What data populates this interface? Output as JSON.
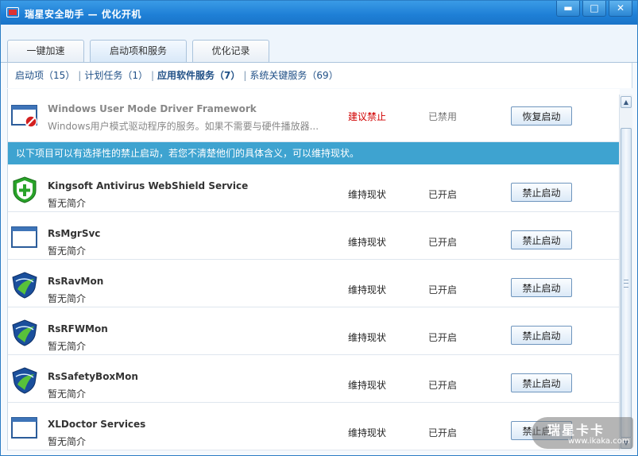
{
  "window": {
    "title": "瑞星安全助手 — 优化开机",
    "minimize_glyph": "▬",
    "maximize_glyph": "□",
    "close_glyph": "✕"
  },
  "tabs": [
    {
      "label": "一键加速",
      "active": false
    },
    {
      "label": "启动项和服务",
      "active": true
    },
    {
      "label": "优化记录",
      "active": false
    }
  ],
  "filters": [
    {
      "label": "启动项（15）",
      "active": false
    },
    {
      "label": "计划任务（1）",
      "active": false
    },
    {
      "label": "应用软件服务（7）",
      "active": true
    },
    {
      "label": "系统关键服务（69）",
      "active": false
    }
  ],
  "filter_separator": "|",
  "disabled_item": {
    "name": "Windows User Mode Driver Framework",
    "description": "Windows用户模式驱动程序的服务。如果不需要与硬件播放器...",
    "advice": "建议禁止",
    "status": "已禁用",
    "action": "恢复启动",
    "icon": "window-disabled-icon"
  },
  "notice": "以下项目可以有选择性的禁止启动，若您不清楚他们的具体含义，可以维持现状。",
  "items": [
    {
      "name": "Kingsoft Antivirus WebShield Service",
      "description": "暂无简介",
      "advice": "维持现状",
      "status": "已开启",
      "action": "禁止启动",
      "icon": "green-shield-icon"
    },
    {
      "name": "RsMgrSvc",
      "description": "暂无简介",
      "advice": "维持现状",
      "status": "已开启",
      "action": "禁止启动",
      "icon": "window-icon"
    },
    {
      "name": "RsRavMon",
      "description": "暂无简介",
      "advice": "维持现状",
      "status": "已开启",
      "action": "禁止启动",
      "icon": "rising-shield-icon"
    },
    {
      "name": "RsRFWMon",
      "description": "暂无简介",
      "advice": "维持现状",
      "status": "已开启",
      "action": "禁止启动",
      "icon": "rising-shield-icon"
    },
    {
      "name": "RsSafetyBoxMon",
      "description": "暂无简介",
      "advice": "维持现状",
      "status": "已开启",
      "action": "禁止启动",
      "icon": "rising-shield-icon"
    },
    {
      "name": "XLDoctor Services",
      "description": "暂无简介",
      "advice": "维持现状",
      "status": "已开启",
      "action": "禁止启动",
      "icon": "window-icon"
    }
  ],
  "scrollbar": {
    "up_glyph": "▲",
    "down_glyph": "▼"
  },
  "watermark": {
    "logo": "瑞星卡卡",
    "url": "www.ikaka.com"
  },
  "colors": {
    "titlebar": "#1e7fd6",
    "notice": "#3ea3d0",
    "advice_red": "#d10000"
  }
}
